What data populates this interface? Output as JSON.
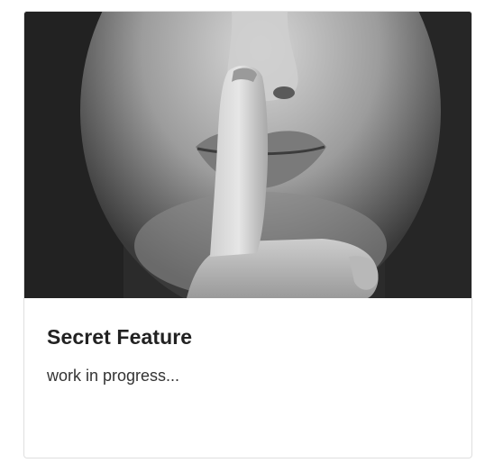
{
  "card": {
    "image_subject": "shush-gesture-photo",
    "title": "Secret Feature",
    "text": "work in progress..."
  },
  "colors": {
    "title": "#222222",
    "text": "#333333",
    "border": "#dfdfdf"
  }
}
